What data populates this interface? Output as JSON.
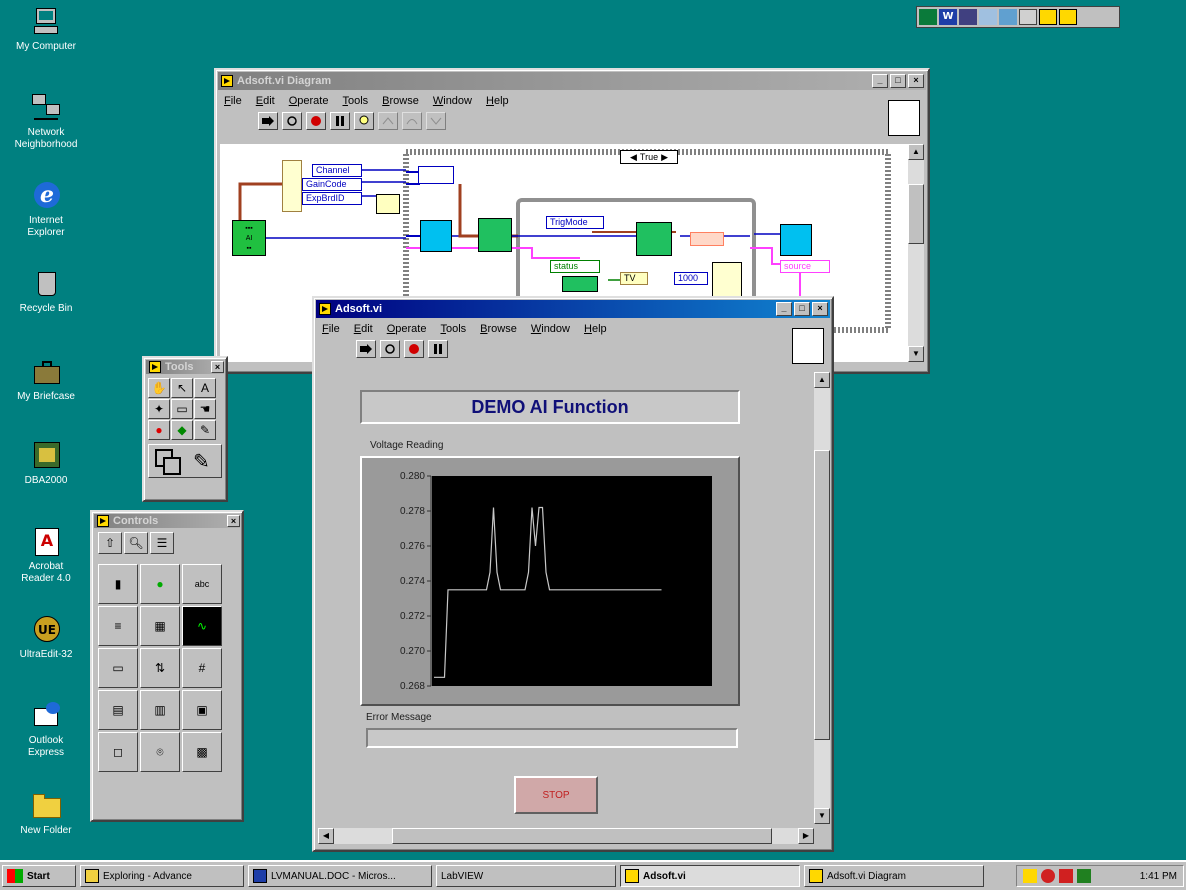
{
  "desktop": {
    "icons": [
      {
        "label": "My Computer"
      },
      {
        "label": "Network\nNeighborhood"
      },
      {
        "label": "Internet\nExplorer"
      },
      {
        "label": "Recycle Bin"
      },
      {
        "label": "My Briefcase"
      },
      {
        "label": "DBA2000"
      },
      {
        "label": "Acrobat\nReader 4.0"
      },
      {
        "label": "UltraEdit-32"
      },
      {
        "label": "Outlook\nExpress"
      },
      {
        "label": "New Folder"
      }
    ]
  },
  "diagram_window": {
    "title": "Adsoft.vi Diagram",
    "menu": [
      "File",
      "Edit",
      "Operate",
      "Tools",
      "Browse",
      "Window",
      "Help"
    ],
    "case_selector": "True",
    "nodes": {
      "channel": "Channel",
      "gaincode": "GainCode",
      "expbrdid": "ExpBrdID",
      "trigmode": "TrigMode",
      "status": "status",
      "source": "source",
      "num1": "1000",
      "type": "TV"
    }
  },
  "panel_window": {
    "title": "Adsoft.vi",
    "menu": [
      "File",
      "Edit",
      "Operate",
      "Tools",
      "Browse",
      "Window",
      "Help"
    ],
    "heading": "DEMO AI Function",
    "chart_label": "Voltage Reading",
    "error_label": "Error Message",
    "error_value": "",
    "stop_label": "STOP"
  },
  "tools_palette": {
    "title": "Tools"
  },
  "controls_palette": {
    "title": "Controls"
  },
  "taskbar": {
    "start": "Start",
    "tasks": [
      {
        "label": "Exploring - Advance"
      },
      {
        "label": "LVMANUAL.DOC - Micros..."
      },
      {
        "label": "LabVIEW"
      },
      {
        "label": "Adsoft.vi",
        "active": true
      },
      {
        "label": "Adsoft.vi Diagram"
      }
    ],
    "clock": "1:41 PM"
  },
  "chart_data": {
    "type": "line",
    "title": "Voltage Reading",
    "xlabel": "",
    "ylabel": "",
    "ylim": [
      0.268,
      0.28
    ],
    "yticks": [
      "0.280",
      "0.278",
      "0.276",
      "0.274",
      "0.272",
      "0.270",
      "0.268"
    ],
    "grid": false,
    "series": [
      {
        "values": [
          0.2685,
          0.2685,
          0.2685,
          0.2685,
          0.2735,
          0.2735,
          0.2735,
          0.2735,
          0.2735,
          0.2735,
          0.2735,
          0.2735,
          0.2735,
          0.2735,
          0.2735,
          0.2735,
          0.2745,
          0.2782,
          0.2745,
          0.2735,
          0.2735,
          0.2735,
          0.2735,
          0.2735,
          0.2735,
          0.2735,
          0.2735,
          0.2745,
          0.2782,
          0.276,
          0.2782,
          0.2782,
          0.2745,
          0.2735,
          0.2735,
          0.2735,
          0.2735,
          0.2735,
          0.2735,
          0.2735,
          0.2735,
          0.2735,
          0.2735,
          0.2735,
          0.2735,
          0.2735,
          0.2735,
          0.2735,
          0.2735,
          0.2735,
          0.2735,
          0.2735,
          0.2735,
          0.2735,
          0.2735,
          0.2735,
          0.2735,
          0.2735,
          0.2735,
          0.2735,
          0.2735,
          0.2735,
          0.2735,
          0.2735,
          0.2735,
          0.2735
        ]
      }
    ]
  },
  "colors": {
    "desktop": "#008080",
    "titlebar_active": "#000080",
    "plot_bg": "#000000",
    "plot_line": "#c8c8c8"
  }
}
